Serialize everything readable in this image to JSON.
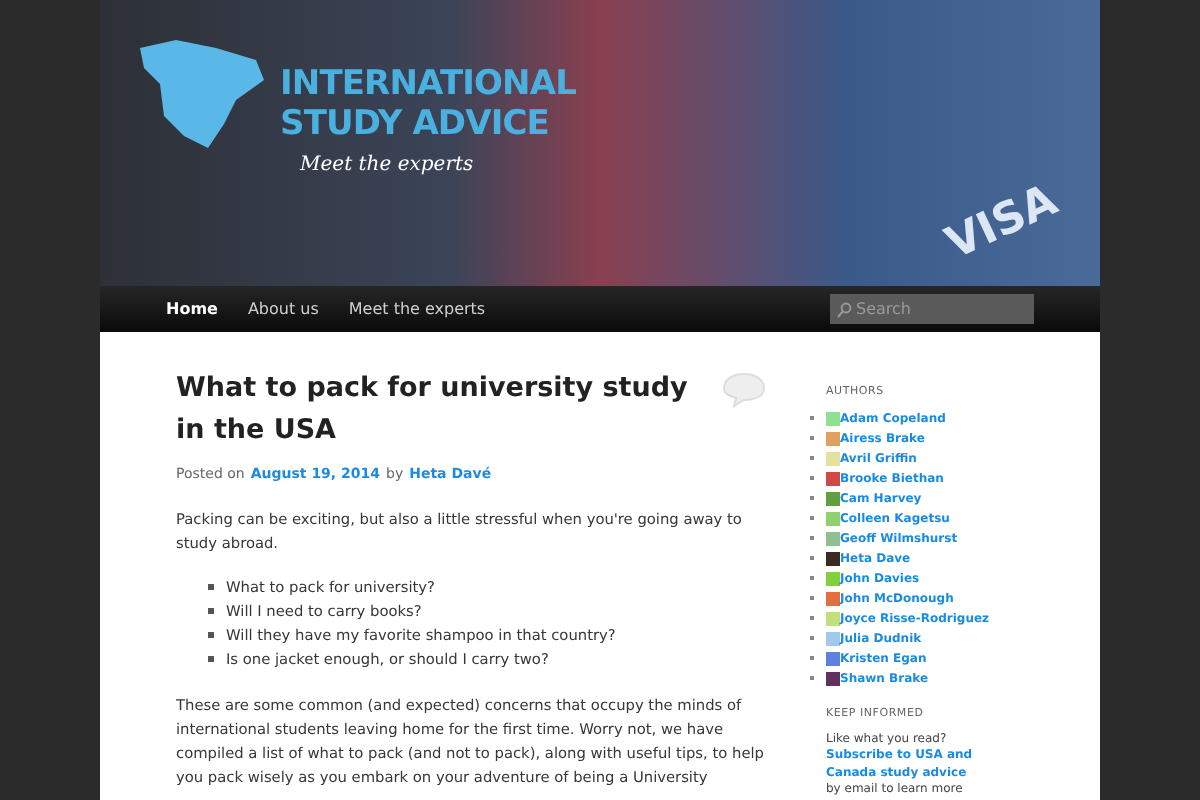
{
  "header": {
    "logo_line1": "INTERNATIONAL",
    "logo_line2": "STUDY ADVICE",
    "tagline": "Meet the experts",
    "banner_word": "VISA"
  },
  "nav": {
    "items": [
      {
        "label": "Home",
        "selected": true
      },
      {
        "label": "About us",
        "selected": false
      },
      {
        "label": "Meet the experts",
        "selected": false
      }
    ],
    "search": {
      "placeholder": "Search"
    }
  },
  "post": {
    "title": "What to pack for university study in the USA",
    "posted_on": "Posted on",
    "date": "August 19, 2014",
    "by": "by",
    "author": "Heta Davé",
    "intro": "Packing can be exciting, but also a little stressful when you're going away to study abroad.",
    "questions": [
      "What to pack for university?",
      "Will I need to carry books?",
      "Will they have my favorite shampoo in that country?",
      "Is one jacket enough, or should I carry two?"
    ],
    "body": "These are some common (and expected) concerns that occupy the minds of international students leaving home for the first time. Worry not, we have compiled a list of what to pack (and not to pack), along with useful tips, to help you pack wisely as you embark on your adventure of being a University"
  },
  "sidebar": {
    "authors_heading": "AUTHORS",
    "authors": [
      {
        "name": "Adam Copeland",
        "color": "#8fe08f"
      },
      {
        "name": "Airess Brake",
        "color": "#e0a060"
      },
      {
        "name": "Avril Griffin",
        "color": "#e8e0a0"
      },
      {
        "name": "Brooke Biethan",
        "color": "#d04848"
      },
      {
        "name": "Cam Harvey",
        "color": "#60a040"
      },
      {
        "name": "Colleen Kagetsu",
        "color": "#90d070"
      },
      {
        "name": "Geoff Wilmshurst",
        "color": "#90c090"
      },
      {
        "name": "Heta Dave",
        "color": "#3a2a20"
      },
      {
        "name": "John Davies",
        "color": "#80d040"
      },
      {
        "name": "John McDonough",
        "color": "#e07040"
      },
      {
        "name": "Joyce Risse-Rodriguez",
        "color": "#c0e080"
      },
      {
        "name": "Julia Dudnik",
        "color": "#a0c8e8"
      },
      {
        "name": "Kristen Egan",
        "color": "#6080e0"
      },
      {
        "name": "Shawn Brake",
        "color": "#603060"
      }
    ],
    "keep_heading": "KEEP INFORMED",
    "keep_text_before": "Like what you read?",
    "keep_link": "Subscribe to USA and Canada study advice",
    "keep_text_after": "by email to learn more"
  }
}
